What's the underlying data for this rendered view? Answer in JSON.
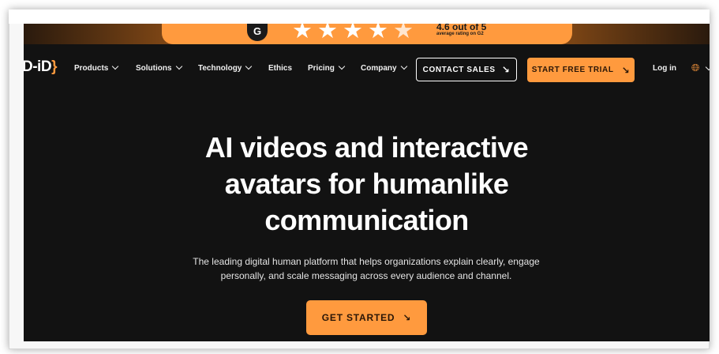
{
  "colors": {
    "accent": "#ff9a3e",
    "background": "#121212",
    "text": "#ffffff"
  },
  "banner": {
    "g2_label": "G",
    "rating_text": "4.6 out of 5",
    "rating_subtext": "average rating on G2",
    "stars": 4.6
  },
  "nav": {
    "logo_text": "D-iD",
    "logo_brace": "}",
    "items": [
      {
        "label": "Products",
        "has_dropdown": true
      },
      {
        "label": "Solutions",
        "has_dropdown": true
      },
      {
        "label": "Technology",
        "has_dropdown": true
      },
      {
        "label": "Ethics",
        "has_dropdown": false
      },
      {
        "label": "Pricing",
        "has_dropdown": true
      },
      {
        "label": "Company",
        "has_dropdown": true
      }
    ],
    "contact_label": "CONTACT SALES",
    "trial_label": "START FREE TRIAL",
    "login_label": "Log in",
    "globe_icon": "globe-icon",
    "arrow_glyph": "↘"
  },
  "hero": {
    "title_line1": "AI videos and interactive",
    "title_line2": "avatars for humanlike",
    "title_line3": "communication",
    "subtitle_line1": "The leading digital human platform that helps organizations explain clearly, engage",
    "subtitle_line2": "personally, and scale messaging across every audience and channel.",
    "cta_label": "GET STARTED"
  }
}
